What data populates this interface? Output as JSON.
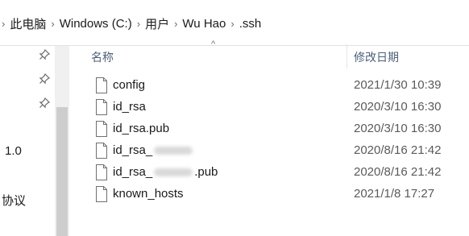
{
  "breadcrumb": {
    "items": [
      "此电脑",
      "Windows (C:)",
      "用户",
      "Wu Hao",
      ".ssh"
    ],
    "separator": "›"
  },
  "nav": {
    "partial_labels": [
      "1.0",
      "协议"
    ],
    "pin_icon": "pin-icon"
  },
  "list": {
    "columns": {
      "name": "名称",
      "date_modified": "修改日期"
    },
    "sort_caret": "^",
    "files": [
      {
        "name": "config",
        "date": "2021/1/30 10:39"
      },
      {
        "name": "id_rsa",
        "date": "2020/3/10 16:30"
      },
      {
        "name": "id_rsa.pub",
        "date": "2020/3/10 16:30"
      },
      {
        "name": "id_rsa_",
        "name_suffix": "",
        "redacted": true,
        "date": "2020/8/16 21:42"
      },
      {
        "name": "id_rsa_",
        "name_suffix": ".pub",
        "redacted": true,
        "date": "2020/8/16 21:42"
      },
      {
        "name": "known_hosts",
        "date": "2021/1/8 17:27"
      }
    ]
  },
  "colors": {
    "header_text": "#4c607a",
    "date_text": "#5a5a5a",
    "scroll_track": "#f0f0f0",
    "scroll_thumb": "#cdcdcd"
  }
}
